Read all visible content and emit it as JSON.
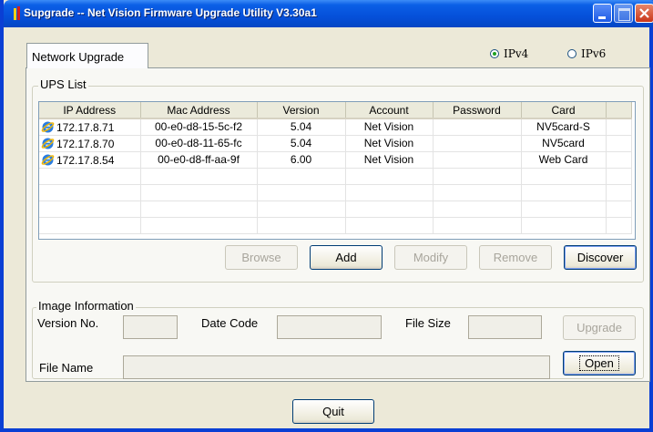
{
  "window": {
    "title": "Supgrade -- Net Vision Firmware Upgrade Utility V3.30a1"
  },
  "tabs": [
    {
      "label": "Network Upgrade"
    }
  ],
  "ip_mode": [
    {
      "label": "IPv4",
      "selected": true
    },
    {
      "label": "IPv6",
      "selected": false
    }
  ],
  "ups_list": {
    "label": "UPS List",
    "columns": [
      "IP Address",
      "Mac Address",
      "Version",
      "Account",
      "Password",
      "Card"
    ],
    "rows": [
      {
        "ip": "172.17.8.71",
        "mac": "00-e0-d8-15-5c-f2",
        "version": "5.04",
        "account": "Net Vision",
        "password": "",
        "card": "NV5card-S"
      },
      {
        "ip": "172.17.8.70",
        "mac": "00-e0-d8-11-65-fc",
        "version": "5.04",
        "account": "Net Vision",
        "password": "",
        "card": "NV5card"
      },
      {
        "ip": "172.17.8.54",
        "mac": "00-e0-d8-ff-aa-9f",
        "version": "6.00",
        "account": "Net Vision",
        "password": "",
        "card": "Web Card"
      }
    ],
    "row_icon": "internet-explorer-icon",
    "buttons": {
      "browse": "Browse",
      "add": "Add",
      "modify": "Modify",
      "remove": "Remove",
      "discover": "Discover"
    }
  },
  "image_info": {
    "label": "Image Information",
    "version_label": "Version No.",
    "version_value": "",
    "date_label": "Date Code",
    "date_value": "",
    "size_label": "File Size",
    "size_value": "",
    "name_label": "File Name",
    "name_value": "",
    "upgrade_button": "Upgrade",
    "open_button": "Open"
  },
  "quit_button": "Quit",
  "colors": {
    "titlebar": "#0550da",
    "window_border": "#0a3fd4",
    "face": "#ece9d8",
    "close": "#c9361a"
  }
}
